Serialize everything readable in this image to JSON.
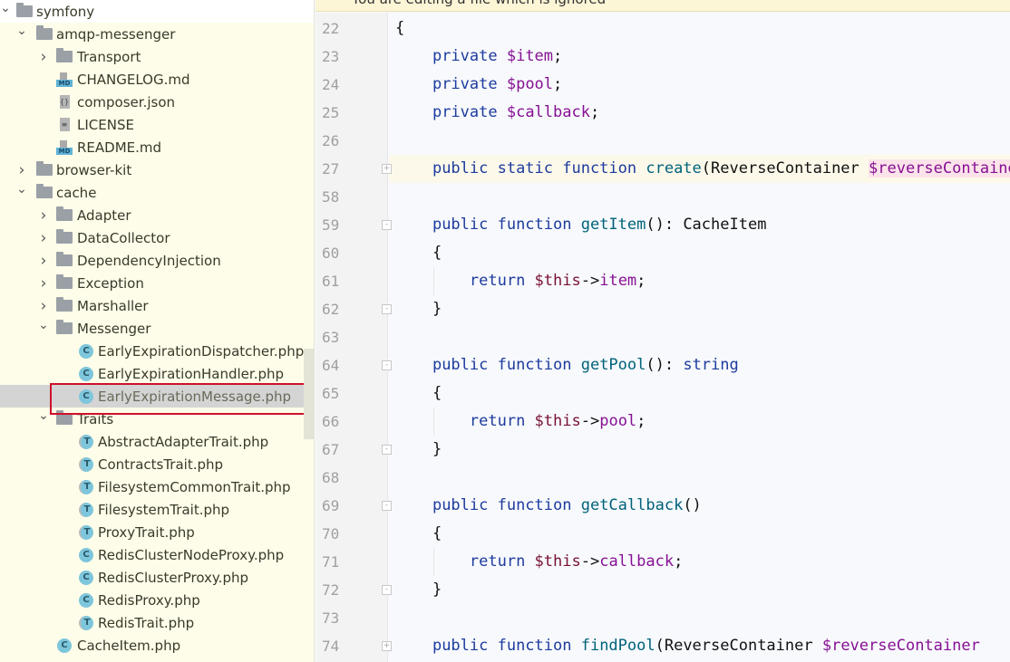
{
  "banner": {
    "text": "You are editing a file which is ignored"
  },
  "tree": [
    {
      "label": "symfony",
      "icon": "folder",
      "level": 0,
      "chevron": "expanded",
      "top": true
    },
    {
      "label": "amqp-messenger",
      "icon": "folder",
      "level": 1,
      "chevron": "expanded"
    },
    {
      "label": "Transport",
      "icon": "folder",
      "level": 2,
      "chevron": "collapsed"
    },
    {
      "label": "CHANGELOG.md",
      "icon": "markdown",
      "level": 2
    },
    {
      "label": "composer.json",
      "icon": "json",
      "level": 2
    },
    {
      "label": "LICENSE",
      "icon": "text",
      "level": 2
    },
    {
      "label": "README.md",
      "icon": "markdown",
      "level": 2
    },
    {
      "label": "browser-kit",
      "icon": "folder",
      "level": 1,
      "chevron": "collapsed"
    },
    {
      "label": "cache",
      "icon": "folder",
      "level": 1,
      "chevron": "expanded"
    },
    {
      "label": "Adapter",
      "icon": "folder",
      "level": 2,
      "chevron": "collapsed"
    },
    {
      "label": "DataCollector",
      "icon": "folder",
      "level": 2,
      "chevron": "collapsed"
    },
    {
      "label": "DependencyInjection",
      "icon": "folder",
      "level": 2,
      "chevron": "collapsed"
    },
    {
      "label": "Exception",
      "icon": "folder",
      "level": 2,
      "chevron": "collapsed"
    },
    {
      "label": "Marshaller",
      "icon": "folder",
      "level": 2,
      "chevron": "collapsed"
    },
    {
      "label": "Messenger",
      "icon": "folder",
      "level": 2,
      "chevron": "expanded"
    },
    {
      "label": "EarlyExpirationDispatcher.php",
      "icon": "class",
      "level": 3
    },
    {
      "label": "EarlyExpirationHandler.php",
      "icon": "class",
      "level": 3
    },
    {
      "label": "EarlyExpirationMessage.php",
      "icon": "class",
      "level": 3,
      "selected": true
    },
    {
      "label": "Traits",
      "icon": "folder",
      "level": 2,
      "chevron": "expanded"
    },
    {
      "label": "AbstractAdapterTrait.php",
      "icon": "trait",
      "level": 3
    },
    {
      "label": "ContractsTrait.php",
      "icon": "trait",
      "level": 3
    },
    {
      "label": "FilesystemCommonTrait.php",
      "icon": "trait",
      "level": 3
    },
    {
      "label": "FilesystemTrait.php",
      "icon": "trait",
      "level": 3
    },
    {
      "label": "ProxyTrait.php",
      "icon": "trait",
      "level": 3
    },
    {
      "label": "RedisClusterNodeProxy.php",
      "icon": "class",
      "level": 3
    },
    {
      "label": "RedisClusterProxy.php",
      "icon": "class",
      "level": 3
    },
    {
      "label": "RedisProxy.php",
      "icon": "class",
      "level": 3
    },
    {
      "label": "RedisTrait.php",
      "icon": "trait",
      "level": 3
    },
    {
      "label": "CacheItem.php",
      "icon": "class",
      "level": 2
    }
  ],
  "code": [
    {
      "n": "22",
      "t": [
        [
          "",
          "{"
        ]
      ]
    },
    {
      "n": "23",
      "t": [
        [
          "",
          "    "
        ],
        [
          "kw",
          "private "
        ],
        [
          "var",
          "$item"
        ],
        [
          "",
          ";"
        ]
      ]
    },
    {
      "n": "24",
      "t": [
        [
          "",
          "    "
        ],
        [
          "kw",
          "private "
        ],
        [
          "var",
          "$pool"
        ],
        [
          "",
          ";"
        ]
      ]
    },
    {
      "n": "25",
      "t": [
        [
          "",
          "    "
        ],
        [
          "kw",
          "private "
        ],
        [
          "var",
          "$callback"
        ],
        [
          "",
          ";"
        ]
      ]
    },
    {
      "n": "26",
      "t": []
    },
    {
      "n": "27",
      "hl": true,
      "fold": "+",
      "t": [
        [
          "",
          "    "
        ],
        [
          "kw",
          "public static function "
        ],
        [
          "fn",
          "create"
        ],
        [
          "",
          "(ReverseContainer "
        ],
        [
          "err",
          "$reverseContainer"
        ]
      ]
    },
    {
      "n": "58",
      "t": []
    },
    {
      "n": "59",
      "fold": "-",
      "t": [
        [
          "",
          "    "
        ],
        [
          "kw",
          "public function "
        ],
        [
          "fn",
          "getItem"
        ],
        [
          "",
          "(): CacheItem"
        ]
      ]
    },
    {
      "n": "60",
      "t": [
        [
          "",
          "    {"
        ]
      ]
    },
    {
      "n": "61",
      "guide": true,
      "t": [
        [
          "",
          "        "
        ],
        [
          "kw",
          "return "
        ],
        [
          "this",
          "$this"
        ],
        [
          "",
          "->"
        ],
        [
          "var",
          "item"
        ],
        [
          "",
          ";"
        ]
      ]
    },
    {
      "n": "62",
      "fold": "-",
      "t": [
        [
          "",
          "    }"
        ]
      ]
    },
    {
      "n": "63",
      "t": []
    },
    {
      "n": "64",
      "fold": "-",
      "t": [
        [
          "",
          "    "
        ],
        [
          "kw",
          "public function "
        ],
        [
          "fn",
          "getPool"
        ],
        [
          "",
          "(): "
        ],
        [
          "kw",
          "string"
        ]
      ]
    },
    {
      "n": "65",
      "t": [
        [
          "",
          "    {"
        ]
      ]
    },
    {
      "n": "66",
      "guide": true,
      "t": [
        [
          "",
          "        "
        ],
        [
          "kw",
          "return "
        ],
        [
          "this",
          "$this"
        ],
        [
          "",
          "->"
        ],
        [
          "var",
          "pool"
        ],
        [
          "",
          ";"
        ]
      ]
    },
    {
      "n": "67",
      "fold": "-",
      "t": [
        [
          "",
          "    }"
        ]
      ]
    },
    {
      "n": "68",
      "t": []
    },
    {
      "n": "69",
      "fold": "-",
      "t": [
        [
          "",
          "    "
        ],
        [
          "kw",
          "public function "
        ],
        [
          "fn",
          "getCallback"
        ],
        [
          "",
          "()"
        ]
      ]
    },
    {
      "n": "70",
      "t": [
        [
          "",
          "    {"
        ]
      ]
    },
    {
      "n": "71",
      "guide": true,
      "t": [
        [
          "",
          "        "
        ],
        [
          "kw",
          "return "
        ],
        [
          "this",
          "$this"
        ],
        [
          "",
          "->"
        ],
        [
          "var",
          "callback"
        ],
        [
          "",
          ";"
        ]
      ]
    },
    {
      "n": "72",
      "fold": "-",
      "t": [
        [
          "",
          "    }"
        ]
      ]
    },
    {
      "n": "73",
      "t": []
    },
    {
      "n": "74",
      "fold": "+",
      "t": [
        [
          "",
          "    "
        ],
        [
          "kw",
          "public function "
        ],
        [
          "fn",
          "findPool"
        ],
        [
          "",
          "(ReverseContainer "
        ],
        [
          "var",
          "$reverseContainer"
        ]
      ]
    }
  ]
}
